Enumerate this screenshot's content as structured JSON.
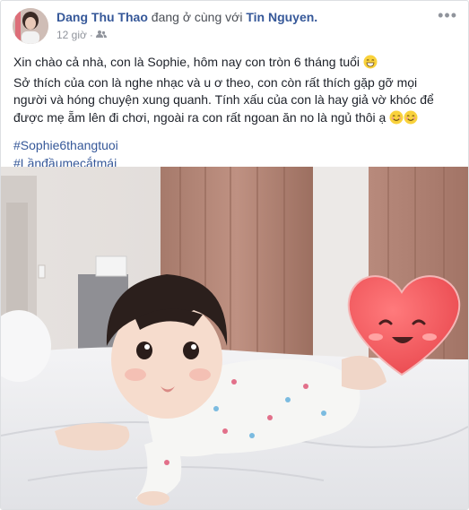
{
  "post": {
    "author": "Dang Thu Thao",
    "with_text": "đang ở cùng với",
    "tagged_user": "Tin Nguyen.",
    "time": "12 giờ",
    "privacy_icon": "friends-icon",
    "menu_icon": "more-options-icon",
    "lines": [
      "Xin chào cả nhà, con là Sophie, hôm nay con tròn 6 tháng tuổi",
      "Sở thích của con là nghe nhạc và u ơ theo, con còn rất thích gặp gỡ mọi",
      "người và hóng chuyện xung quanh. Tính xấu của con là hay giả vờ khóc để",
      "được mẹ ẵm lên đi chơi, ngoài ra con rất ngoan ăn no là ngủ thôi ạ"
    ],
    "hashtags": [
      "#Sophie6thangtuoi",
      "#Lầnđầumẹcắtmái"
    ],
    "emoji_icons": [
      "grinning-face-icon",
      "smiling-face-icon"
    ]
  },
  "colors": {
    "link": "#365899",
    "text": "#1d2129",
    "meta": "#90949c",
    "heart": "#f0575a"
  }
}
